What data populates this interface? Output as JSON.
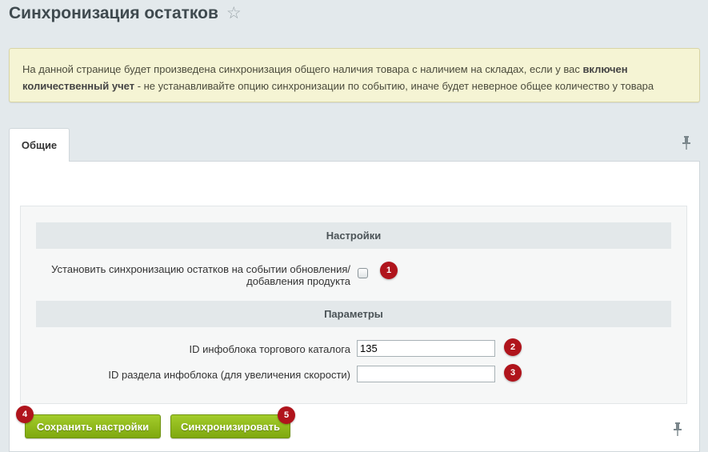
{
  "page": {
    "title": "Синхронизация остатков",
    "favorite_icon": "star-icon"
  },
  "notice": {
    "text_before": "На данной странице будет произведена синхронизация общего наличия товара с наличием на складах, если у вас ",
    "text_bold": "включен количественный учет",
    "text_after": " - не устанавливайте опцию синхронизации по событию, иначе будет неверное общее количество у товара"
  },
  "tabs": [
    {
      "label": "Общие",
      "active": true
    }
  ],
  "form": {
    "section_settings": "Настройки",
    "sync_event_label_line1": "Установить синхронизацию остатков на событии обновления/",
    "sync_event_label_line2": "добавления продукта",
    "sync_event_checked": false,
    "section_params": "Параметры",
    "iblock_id_label": "ID инфоблока торгового каталога",
    "iblock_id_value": "135",
    "section_id_label": "ID раздела инфоблока (для увеличения скорости)",
    "section_id_value": ""
  },
  "buttons": {
    "save_label": "Сохранить настройки",
    "sync_label": "Синхронизировать"
  },
  "badges": [
    "1",
    "2",
    "3",
    "4",
    "5"
  ],
  "colors": {
    "badge": "#b0141c",
    "button": "#8cb61a",
    "notice_bg": "#f5f4d4"
  },
  "icons": {
    "pin": "pin-icon"
  }
}
